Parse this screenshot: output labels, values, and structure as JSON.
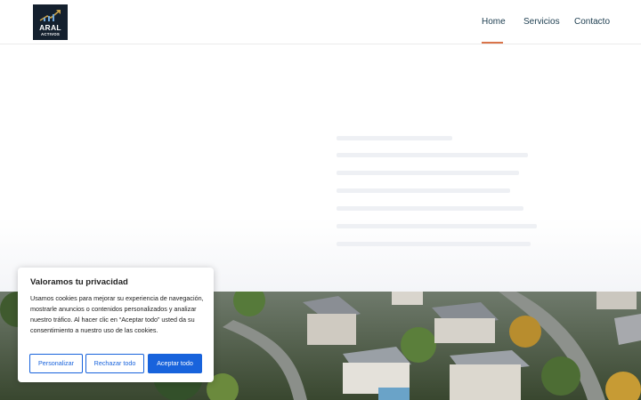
{
  "logo": {
    "line1": "ARAL",
    "line2": "ACTIVOS"
  },
  "nav": {
    "items": [
      {
        "label": "Home"
      },
      {
        "label": "Servicios"
      },
      {
        "label": "Contacto"
      }
    ]
  },
  "cookie_banner": {
    "title": "Valoramos tu privacidad",
    "body": "Usamos cookies para mejorar su experiencia de navegación, mostrarle anuncios o contenidos personalizados y analizar nuestro tráfico. Al hacer clic en “Aceptar todo” usted da su consentimiento a nuestro uso de las cookies.",
    "customize_label": "Personalizar",
    "reject_label": "Rechazar todo",
    "accept_label": "Aceptar todo"
  },
  "colors": {
    "brand_dark": "#14202e",
    "nav_text": "#1c3d4f",
    "nav_active_underline": "#d9744a",
    "button_primary": "#1863dc"
  },
  "icons": [
    "logo-arrow-icon"
  ]
}
